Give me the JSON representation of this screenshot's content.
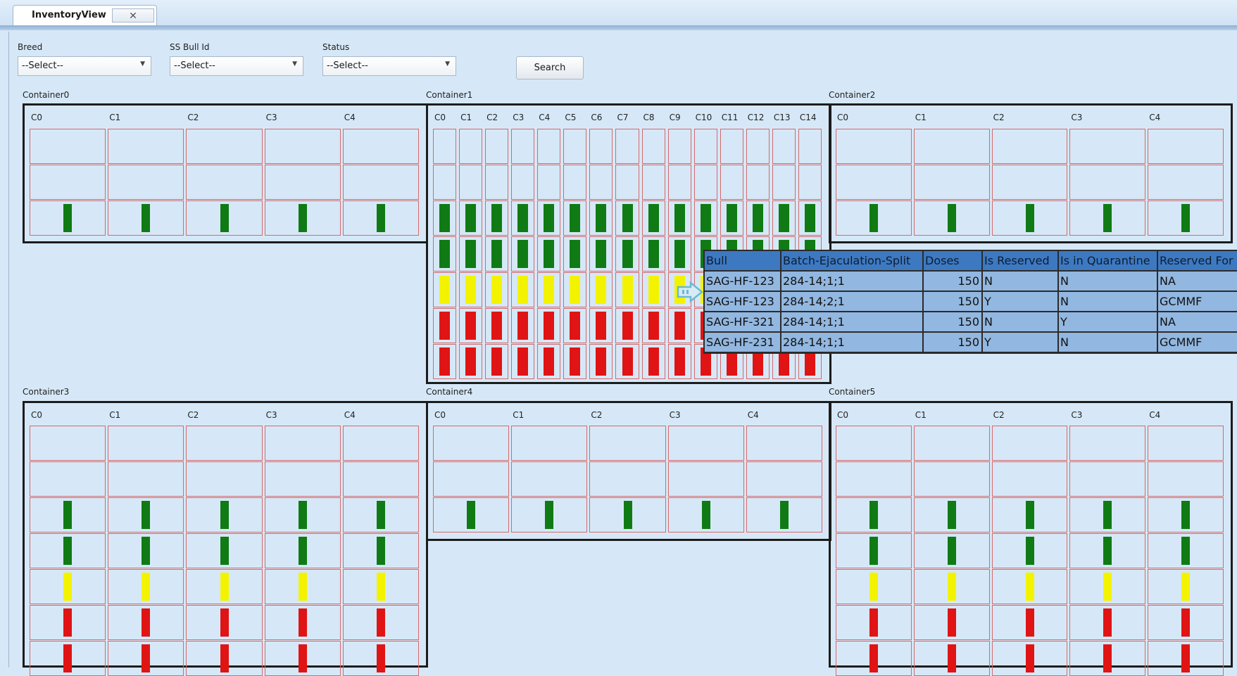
{
  "tab": {
    "title": "InventoryView",
    "close": "✕"
  },
  "filters": {
    "breed": {
      "label": "Breed",
      "value": "--Select--"
    },
    "bull": {
      "label": "SS Bull Id",
      "value": "--Select--"
    },
    "status": {
      "label": "Status",
      "value": "--Select--"
    },
    "search_label": "Search"
  },
  "colors": {
    "green": "#107b14",
    "yellow": "#f3f300",
    "red": "#e01414",
    "cell_border": "#d4696b"
  },
  "containers": [
    {
      "title": "Container0",
      "columns": [
        "C0",
        "C1",
        "C2",
        "C3",
        "C4"
      ],
      "rows": [
        "empty",
        "empty",
        "green"
      ]
    },
    {
      "title": "Container1",
      "columns": [
        "C0",
        "C1",
        "C2",
        "C3",
        "C4",
        "C5",
        "C6",
        "C7",
        "C8",
        "C9",
        "C10",
        "C11",
        "C12",
        "C13",
        "C14"
      ],
      "rows": [
        "empty",
        "empty",
        "green",
        "green",
        "yellow",
        "red",
        "red"
      ]
    },
    {
      "title": "Container2",
      "columns": [
        "C0",
        "C1",
        "C2",
        "C3",
        "C4"
      ],
      "rows": [
        "empty",
        "empty",
        "green"
      ]
    },
    {
      "title": "Container3",
      "columns": [
        "C0",
        "C1",
        "C2",
        "C3",
        "C4"
      ],
      "rows": [
        "empty",
        "empty",
        "green",
        "green",
        "yellow",
        "red",
        "red"
      ]
    },
    {
      "title": "Container4",
      "columns": [
        "C0",
        "C1",
        "C2",
        "C3",
        "C4"
      ],
      "rows": [
        "empty",
        "empty",
        "green"
      ]
    },
    {
      "title": "Container5",
      "columns": [
        "C0",
        "C1",
        "C2",
        "C3",
        "C4"
      ],
      "rows": [
        "empty",
        "empty",
        "green",
        "green",
        "yellow",
        "red",
        "red"
      ]
    }
  ],
  "tooltip": {
    "headers": [
      "Bull",
      "Batch-Ejaculation-Split",
      "Doses",
      "Is Reserved",
      "Is in Quarantine",
      "Reserved For"
    ],
    "rows": [
      [
        "SAG-HF-123",
        "284-14;1;1",
        "150",
        "N",
        "N",
        "NA"
      ],
      [
        "SAG-HF-123",
        "284-14;2;1",
        "150",
        "Y",
        "N",
        "GCMMF"
      ],
      [
        "SAG-HF-321",
        "284-14;1;1",
        "150",
        "N",
        "Y",
        "NA"
      ],
      [
        "SAG-HF-231",
        "284-14;1;1",
        "150",
        "Y",
        "N",
        "GCMMF"
      ]
    ]
  }
}
